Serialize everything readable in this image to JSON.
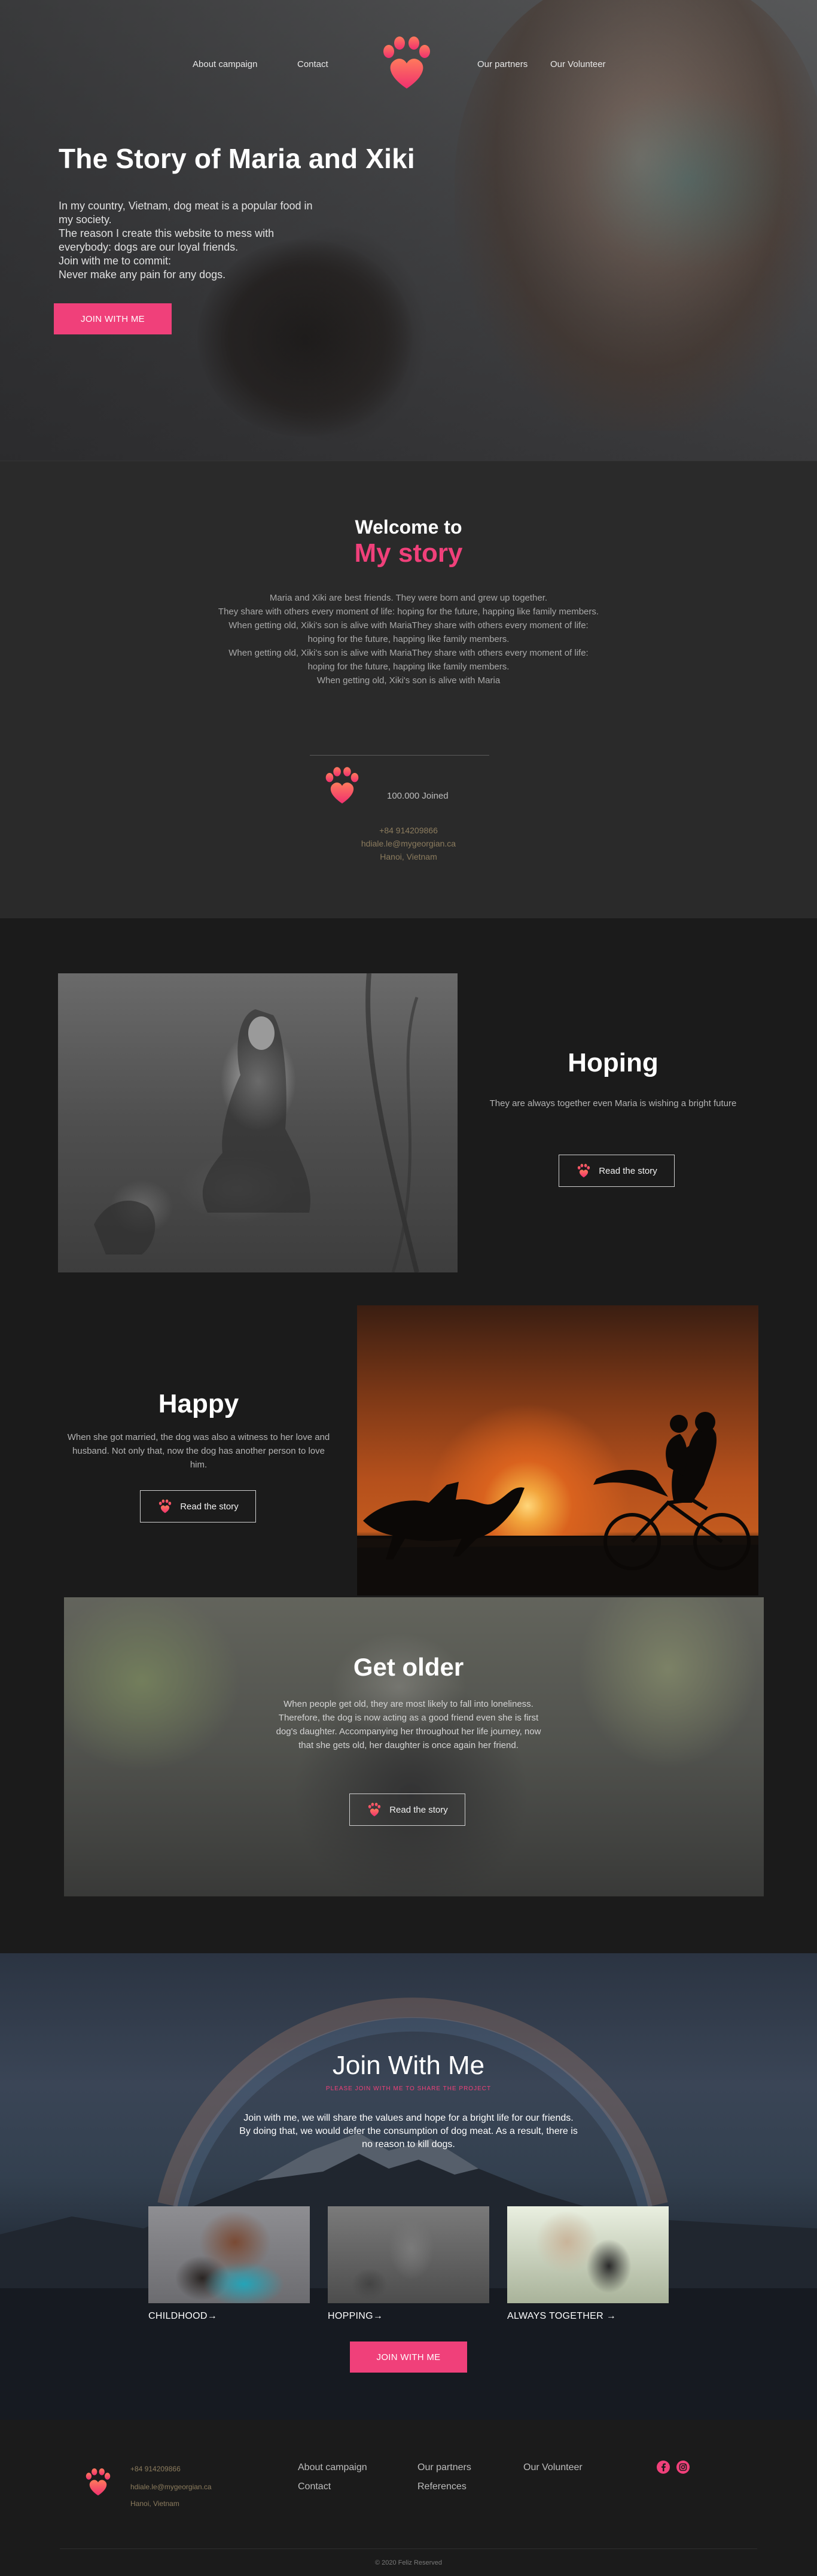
{
  "nav": {
    "about": "About campaign",
    "contact": "Contact",
    "partners": "Our partners",
    "volunteer": "Our Volunteer"
  },
  "hero": {
    "title": "The Story of Maria and Xiki",
    "lines": [
      "In my country, Vietnam, dog meat is a popular food in",
      "my society.",
      "The reason I create this website to mess with",
      "everybody: dogs are our loyal friends.",
      "Join with me to commit:",
      "Never make any pain for any dogs."
    ],
    "cta": "JOIN WITH ME"
  },
  "welcome": {
    "heading": "Welcome to",
    "subheading": "My story",
    "lines": [
      "Maria and Xiki are best friends. They were born and grew up together.",
      "They share with others every moment of life: hoping for the future, happing like family members.",
      "When getting old, Xiki's son is alive with MariaThey share with others every moment of life:",
      "hoping for the future, happing like family members.",
      "When getting old, Xiki's son is alive with MariaThey share with others every moment of life:",
      "hoping for the future, happing like family members.",
      "When getting old, Xiki's son is alive with Maria"
    ],
    "joined": "100.000 Joined",
    "phone": "+84 914209866",
    "email": "hdiale.le@mygeorgian.ca",
    "address": "Hanoi, Vietnam"
  },
  "sections": {
    "hoping": {
      "title": "Hoping",
      "text": "They are always together even Maria is wishing a bright future",
      "button": "Read the story"
    },
    "happy": {
      "title": "Happy",
      "text_lines": [
        "When she got married, the dog was also a witness to her love and",
        "husband. Not only that, now the dog has another person to love",
        "him."
      ],
      "button": "Read the story"
    },
    "older": {
      "title": "Get older",
      "text_lines": [
        "When people get old, they are most likely to fall into loneliness.",
        "Therefore, the dog is now acting as a good friend even she is first",
        "dog's daughter. Accompanying her throughout her life journey, now",
        "that she gets old, her daughter is once again her friend."
      ],
      "button": "Read the story"
    }
  },
  "join": {
    "title": "Join With Me",
    "tagline": "PLEASE JOIN WITH ME TO SHARE THE PROJECT",
    "lines": [
      "Join with me, we will share the values and hope for a bright life for our friends.",
      "By doing that, we would defer the consumption of dog meat. As a result, there is",
      "no reason to kill dogs."
    ],
    "cards": [
      {
        "label": "CHILDHOOD"
      },
      {
        "label": "HOPPING"
      },
      {
        "label": "ALWAYS TOGETHER"
      }
    ],
    "arrow": "→",
    "cta": "JOIN WITH ME"
  },
  "footer": {
    "phone": "+84 914209866",
    "email": "hdiale.le@mygeorgian.ca",
    "address": "Hanoi, Vietnam",
    "links": {
      "about": "About campaign",
      "contact": "Contact",
      "partners": "Our partners",
      "references": "References",
      "volunteer": "Our Volunteer"
    },
    "copyright": "© 2020 Feliz Reserved"
  },
  "colors": {
    "accent": "#f0407a",
    "gold": "#8c7c5e",
    "background": "#1b1b1b",
    "welcome_bg": "#2a2a2a"
  },
  "icons": [
    "paw-heart-icon",
    "facebook-icon",
    "instagram-icon",
    "arrow-right-icon"
  ]
}
